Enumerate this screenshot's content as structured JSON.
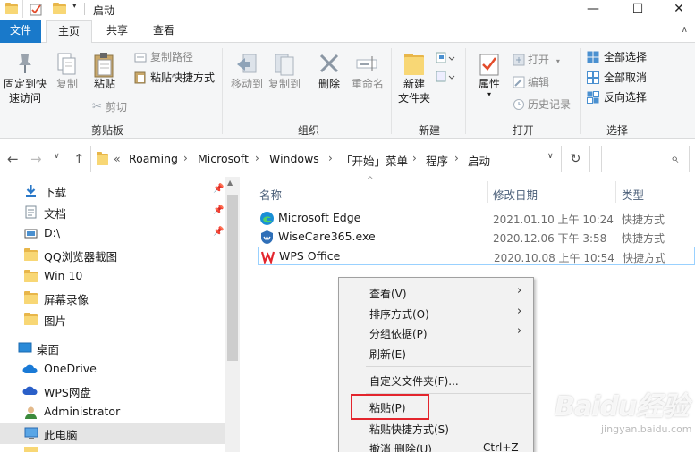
{
  "window": {
    "title": "启动",
    "min": "—",
    "max": "☐",
    "close": "✕"
  },
  "ribbon_tabs": {
    "file": "文件",
    "home": "主页",
    "share": "共享",
    "view": "查看"
  },
  "clipboard": {
    "pin": "固定到快\n速访问",
    "copy": "复制",
    "paste": "粘贴",
    "cut": "剪切",
    "copy_path": "复制路径",
    "paste_shortcut": "粘贴快捷方式",
    "label": "剪贴板"
  },
  "organize": {
    "move_to": "移动到",
    "copy_to": "复制到",
    "delete": "删除",
    "rename": "重命名",
    "label": "组织"
  },
  "new": {
    "new_folder": "新建\n文件夹",
    "label": "新建"
  },
  "open": {
    "properties": "属性",
    "open": "打开",
    "edit": "编辑",
    "history": "历史记录",
    "label": "打开"
  },
  "select": {
    "select_all": "全部选择",
    "select_none": "全部取消",
    "invert": "反向选择",
    "label": "选择"
  },
  "address": {
    "prefix": "«",
    "crumbs": [
      "Roaming",
      "Microsoft",
      "Windows",
      "「开始」菜单",
      "程序",
      "启动"
    ],
    "refresh": "↻",
    "search_icon": "⌕"
  },
  "nav": {
    "items": [
      {
        "label": "下载",
        "icon": "download-icon"
      },
      {
        "label": "文档",
        "icon": "document-icon"
      },
      {
        "label": "D:\\",
        "icon": "drive-icon"
      },
      {
        "label": "QQ浏览器截图",
        "icon": "folder-icon"
      },
      {
        "label": "Win 10",
        "icon": "folder-icon"
      },
      {
        "label": "屏幕录像",
        "icon": "folder-icon"
      },
      {
        "label": "图片",
        "icon": "folder-icon"
      },
      {
        "label": "桌面",
        "icon": "desktop-icon"
      },
      {
        "label": "OneDrive",
        "icon": "cloud-icon"
      },
      {
        "label": "WPS网盘",
        "icon": "wps-cloud-icon"
      },
      {
        "label": "Administrator",
        "icon": "user-icon"
      },
      {
        "label": "此电脑",
        "icon": "computer-icon"
      }
    ]
  },
  "columns": {
    "name": "名称",
    "date": "修改日期",
    "type": "类型"
  },
  "files": [
    {
      "name": "Microsoft Edge",
      "date": "2021.01.10 上午 10:24",
      "type": "快捷方式",
      "icon_color": "#1a8fd6"
    },
    {
      "name": "WiseCare365.exe",
      "date": "2020.12.06 下午 3:58",
      "type": "快捷方式",
      "icon_color": "#2f6fb8"
    },
    {
      "name": "WPS Office",
      "date": "2020.10.08 上午 10:54",
      "type": "快捷方式",
      "icon_color": "#e3252d"
    }
  ],
  "context_menu": {
    "view": "查看(V)",
    "sort": "排序方式(O)",
    "group": "分组依据(P)",
    "refresh": "刷新(E)",
    "customize": "自定义文件夹(F)...",
    "paste": "粘贴(P)",
    "paste_shortcut": "粘贴快捷方式(S)",
    "undo": "撤消 删除(U)",
    "undo_shortcut": "Ctrl+Z"
  },
  "watermark": {
    "brand": "Baidu经验",
    "url": "jingyan.baidu.com"
  },
  "colors": {
    "accent": "#1979ca",
    "highlight_red": "#e3252d",
    "folder": "#f8d775"
  }
}
